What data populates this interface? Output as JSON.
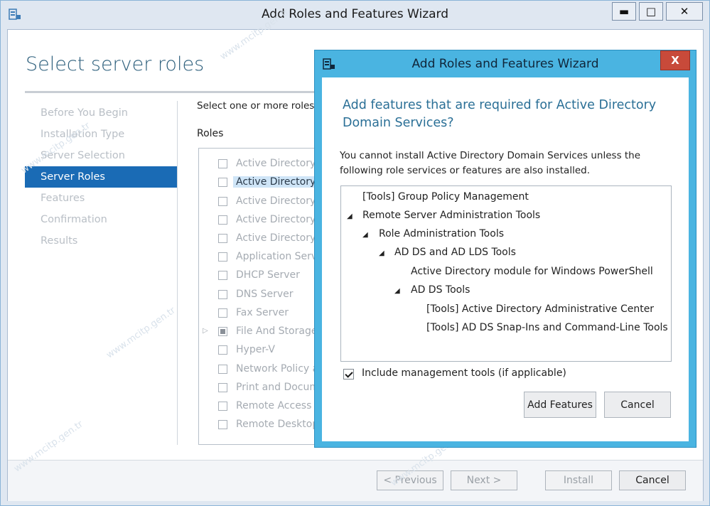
{
  "window": {
    "title": "Add Roles and Features Wizard"
  },
  "page": {
    "title": "Select server roles",
    "instruction": "Select one or more roles t",
    "roles_heading": "Roles"
  },
  "nav": [
    "Before You Begin",
    "Installation Type",
    "Server Selection",
    "Server Roles",
    "Features",
    "Confirmation",
    "Results"
  ],
  "roles": [
    "Active Directory C",
    "Active Directory D",
    "Active Directory F",
    "Active Directory L",
    "Active Directory R",
    "Application Serve",
    "DHCP Server",
    "DNS Server",
    "Fax Server",
    "File And Storage",
    "Hyper-V",
    "Network Policy a",
    "Print and Docum",
    "Remote Access",
    "Remote Desktop"
  ],
  "footer": {
    "previous": "< Previous",
    "next": "Next >",
    "install": "Install",
    "cancel": "Cancel"
  },
  "dialog": {
    "title": "Add Roles and Features Wizard",
    "close": "X",
    "heading": "Add features that are required for Active Directory Domain Services?",
    "description": "You cannot install Active Directory Domain Services unless the following role services or features are also installed.",
    "tree": [
      "[Tools] Group Policy Management",
      "Remote Server Administration Tools",
      "Role Administration Tools",
      "AD DS and AD LDS Tools",
      "Active Directory module for Windows PowerShell",
      "AD DS Tools",
      "[Tools] Active Directory Administrative Center",
      "[Tools] AD DS Snap-Ins and Command-Line Tools"
    ],
    "include_label": "Include management tools (if applicable)",
    "include_checked": true,
    "add_button": "Add Features",
    "cancel_button": "Cancel"
  },
  "watermark": "www.mcitp.gen.tr"
}
